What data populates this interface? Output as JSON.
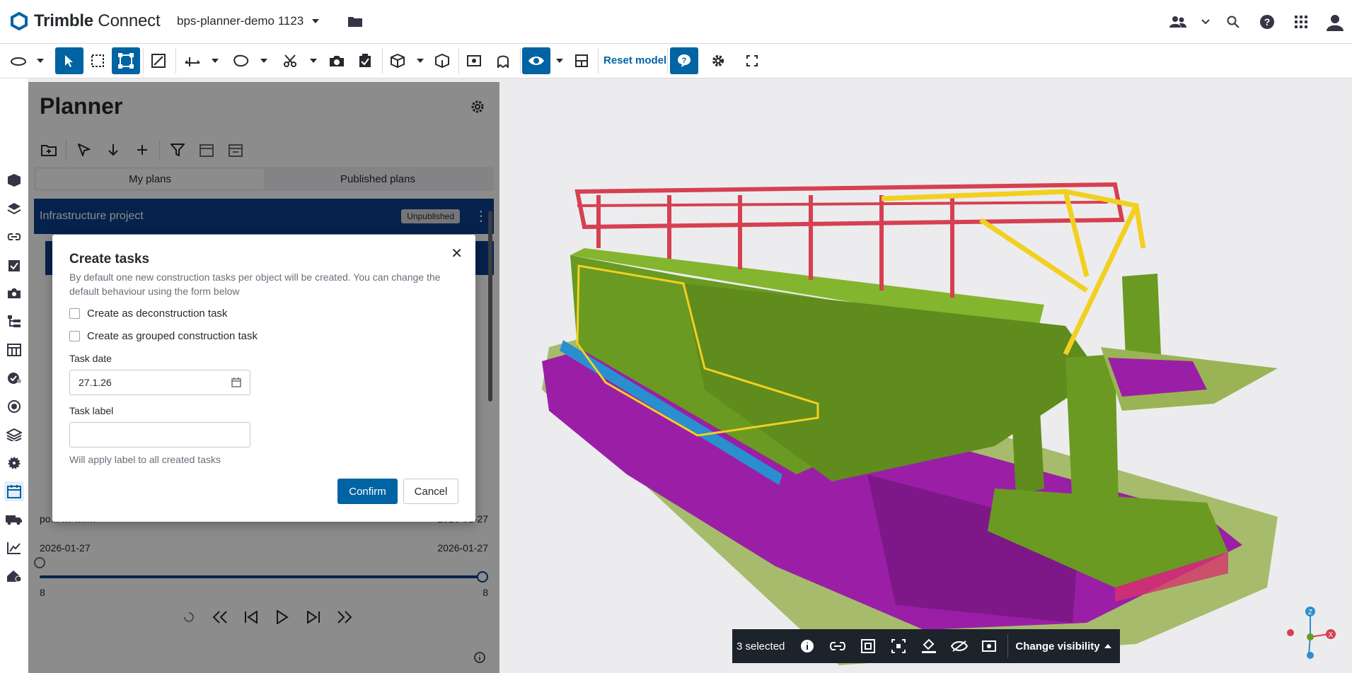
{
  "app": {
    "brand_bold": "Trimble",
    "brand_light": " Connect",
    "project": "bps-planner-demo 1123"
  },
  "toolbar": {
    "reset_model": "Reset model"
  },
  "planner": {
    "title": "Planner",
    "tabs": [
      {
        "label": "My plans"
      },
      {
        "label": "Published plans"
      }
    ],
    "plan": {
      "name": "Infrastructure project",
      "badge": "Unpublished"
    },
    "row_left": "po... … …l…",
    "row_right": "2026-01-27",
    "range": {
      "start_date": "2026-01-27",
      "end_date": "2026-01-27",
      "start_num": "8",
      "end_num": "8"
    }
  },
  "modal": {
    "title": "Create tasks",
    "description": "By default one new construction tasks per object will be created. You can change the default behaviour using the form below",
    "opt_deconstruction": "Create as deconstruction task",
    "opt_grouped": "Create as grouped construction task",
    "task_date_label": "Task date",
    "task_date_value": "27.1.26",
    "task_label_label": "Task label",
    "task_label_value": "",
    "hint": "Will apply label to all created tasks",
    "confirm": "Confirm",
    "cancel": "Cancel"
  },
  "selection": {
    "count_text": "3 selected",
    "change_visibility": "Change visibility"
  },
  "colors": {
    "brand": "#0063a3",
    "navy": "#0a3f8a",
    "green": "#6a9a22",
    "purple": "#9b1fa6",
    "red": "#d64050",
    "yellow": "#f2d020"
  }
}
